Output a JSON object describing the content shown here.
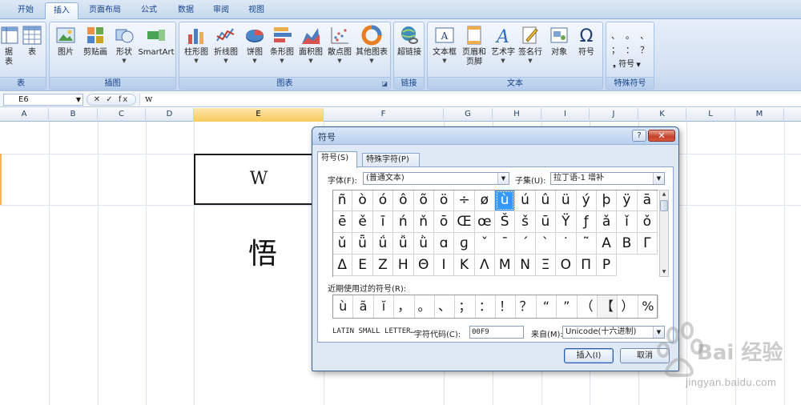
{
  "ribbon": {
    "tabs": [
      "开始",
      "插入",
      "页面布局",
      "公式",
      "数据",
      "审阅",
      "视图"
    ],
    "active_tab": "插入",
    "groups": {
      "table": {
        "label": "表",
        "buttons": [
          {
            "label": "据",
            "sub": "表",
            "icon": "pivot-table-icon"
          },
          {
            "label": "表",
            "icon": "table-icon"
          }
        ]
      },
      "illustrations": {
        "label": "插图",
        "buttons": [
          {
            "label": "图片",
            "icon": "picture-icon"
          },
          {
            "label": "剪贴画",
            "icon": "clipart-icon"
          },
          {
            "label": "形状",
            "icon": "shapes-icon"
          },
          {
            "label": "SmartArt",
            "icon": "smartart-icon"
          }
        ]
      },
      "charts": {
        "label": "图表",
        "buttons": [
          {
            "label": "柱形图",
            "icon": "column-chart-icon"
          },
          {
            "label": "折线图",
            "icon": "line-chart-icon"
          },
          {
            "label": "饼图",
            "icon": "pie-chart-icon"
          },
          {
            "label": "条形图",
            "icon": "bar-chart-icon"
          },
          {
            "label": "面积图",
            "icon": "area-chart-icon"
          },
          {
            "label": "散点图",
            "icon": "scatter-chart-icon"
          },
          {
            "label": "其他图表",
            "icon": "other-charts-icon"
          }
        ]
      },
      "links": {
        "label": "链接",
        "buttons": [
          {
            "label": "超链接",
            "icon": "hyperlink-icon"
          }
        ]
      },
      "text": {
        "label": "文本",
        "buttons": [
          {
            "label": "文本框",
            "icon": "textbox-icon"
          },
          {
            "label": "页眉和",
            "sub": "页脚",
            "icon": "header-footer-icon"
          },
          {
            "label": "艺术字",
            "icon": "wordart-icon"
          },
          {
            "label": "签名行",
            "icon": "signature-line-icon"
          },
          {
            "label": "对象",
            "icon": "object-icon"
          },
          {
            "label": "符号",
            "icon": "omega-icon"
          }
        ]
      },
      "special": {
        "label": "特殊符号",
        "marks_row1": "、  。  、",
        "marks_row2": "；  ：  ？",
        "symbol_label": "符号"
      }
    }
  },
  "formula_bar": {
    "name_box": "E6",
    "buttons": "✕ ✓ fx",
    "content": "w"
  },
  "grid": {
    "columns": [
      "A",
      "B",
      "C",
      "D",
      "E",
      "F",
      "G",
      "H",
      "I",
      "J",
      "K",
      "L",
      "M"
    ],
    "selected_column": "E",
    "cell_text": "W",
    "big_char": "悟"
  },
  "dialog": {
    "title": "符号",
    "help": "?",
    "close": "✕",
    "tabs": [
      "符号(S)",
      "特殊字符(P)"
    ],
    "font_label": "字体(F):",
    "font_value": "(普通文本)",
    "subset_label": "子集(U):",
    "subset_value": "拉丁语-1 增补",
    "symbols": [
      "ñ",
      "ò",
      "ó",
      "ô",
      "õ",
      "ö",
      "÷",
      "ø",
      "ù",
      "ú",
      "û",
      "ü",
      "ý",
      "þ",
      "ÿ",
      "ā",
      "ē",
      "ě",
      "ī",
      "ń",
      "ň",
      "ō",
      "Œ",
      "œ",
      "Š",
      "š",
      "ū",
      "Ÿ",
      "ƒ",
      "ǎ",
      "ǐ",
      "ǒ",
      "ǔ",
      "ǖ",
      "ǘ",
      "ǚ",
      "ǜ",
      "ɑ",
      "ɡ",
      "ˇ",
      "ˉ",
      "ˊ",
      "ˋ",
      "˙",
      "˜",
      "Α",
      "Β",
      "Γ",
      "Δ",
      "Ε",
      "Ζ",
      "Η",
      "Θ",
      "Ι",
      "Κ",
      "Λ",
      "Μ",
      "Ν",
      "Ξ",
      "Ο",
      "Π",
      "Ρ"
    ],
    "selected_symbol": "ù",
    "recent_label": "近期使用过的符号(R):",
    "recent": [
      "ù",
      "ã",
      "ĭ",
      "，",
      "。",
      "、",
      "；",
      "：",
      "！",
      "？",
      "“",
      "”",
      "（",
      "【",
      "）",
      "%"
    ],
    "char_name": "LATIN SMALL LETTER…",
    "code_label": "字符代码(C):",
    "code_value": "00F9",
    "from_label": "来自(M):",
    "from_value": "Unicode(十六进制)",
    "insert_label": "插入(I)",
    "cancel_label": "取消"
  },
  "watermark": {
    "brand": "Bai 经验",
    "url": "jingyan.baidu.com"
  }
}
